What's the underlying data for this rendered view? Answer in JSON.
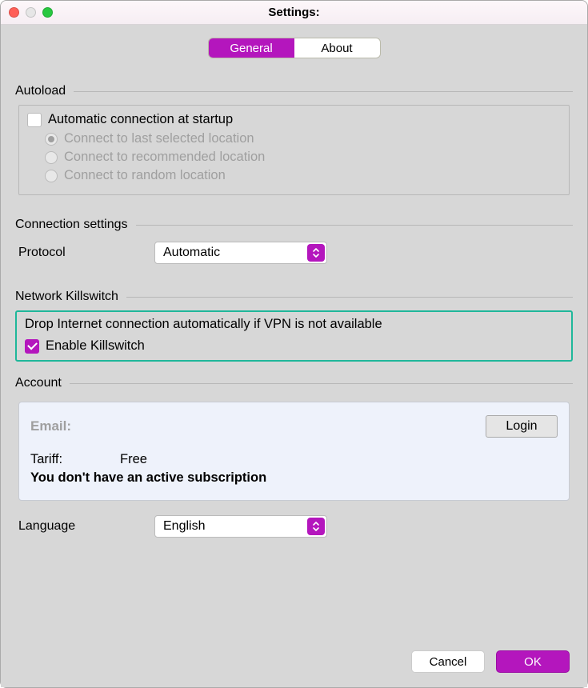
{
  "window": {
    "title": "Settings:"
  },
  "tabs": {
    "general": "General",
    "about": "About"
  },
  "sections": {
    "autoload": "Autoload",
    "connection": "Connection settings",
    "killswitch": "Network Killswitch",
    "account": "Account"
  },
  "autoload": {
    "checkbox_label": "Automatic connection at startup",
    "checkbox_checked": false,
    "radios": [
      {
        "label": "Connect to last selected location",
        "selected": true
      },
      {
        "label": "Connect to recommended location",
        "selected": false
      },
      {
        "label": "Connect to random location",
        "selected": false
      }
    ]
  },
  "connection": {
    "protocol_label": "Protocol",
    "protocol_value": "Automatic"
  },
  "killswitch": {
    "description": "Drop Internet connection automatically if VPN is not available",
    "checkbox_label": "Enable Killswitch",
    "checkbox_checked": true
  },
  "account": {
    "email_label": "Email:",
    "login_label": "Login",
    "tariff_label": "Tariff:",
    "tariff_value": "Free",
    "subscription_msg": "You don't have an active subscription"
  },
  "language": {
    "label": "Language",
    "value": "English"
  },
  "footer": {
    "cancel": "Cancel",
    "ok": "OK"
  },
  "colors": {
    "accent": "#b416bd",
    "highlight_border": "#1fb79a"
  }
}
